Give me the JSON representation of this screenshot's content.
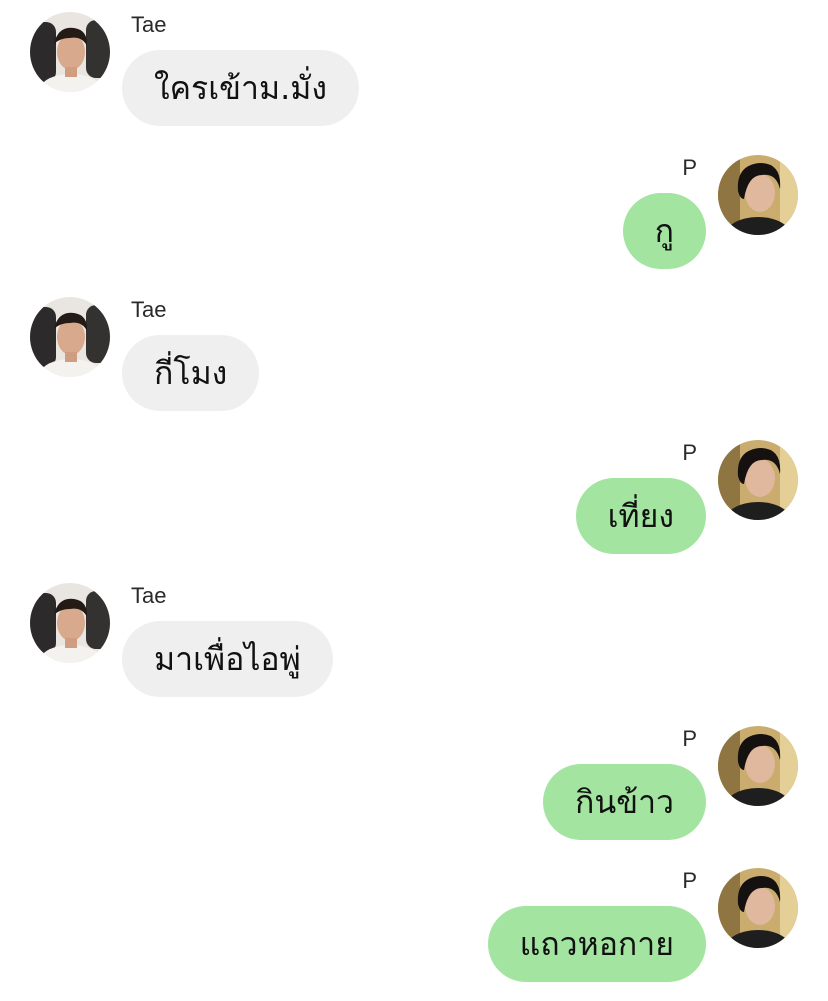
{
  "colors": {
    "incoming_bubble": "#efefef",
    "outgoing_bubble": "#a3e4a0",
    "background": "#ffffff"
  },
  "messages": [
    {
      "direction": "incoming",
      "sender": "Tae",
      "text": "ใครเข้าม.มั่ง",
      "avatar": "tae-avatar"
    },
    {
      "direction": "outgoing",
      "sender": "P",
      "text": "กู",
      "avatar": "p-avatar"
    },
    {
      "direction": "incoming",
      "sender": "Tae",
      "text": "กี่โมง",
      "avatar": "tae-avatar"
    },
    {
      "direction": "outgoing",
      "sender": "P",
      "text": "เที่ยง",
      "avatar": "p-avatar"
    },
    {
      "direction": "incoming",
      "sender": "Tae",
      "text": "มาเพื่อไอพู่",
      "avatar": "tae-avatar"
    },
    {
      "direction": "outgoing",
      "sender": "P",
      "text": "กินข้าว",
      "avatar": "p-avatar"
    },
    {
      "direction": "outgoing",
      "sender": "P",
      "text": "แถวหอกาย",
      "avatar": "p-avatar"
    }
  ]
}
